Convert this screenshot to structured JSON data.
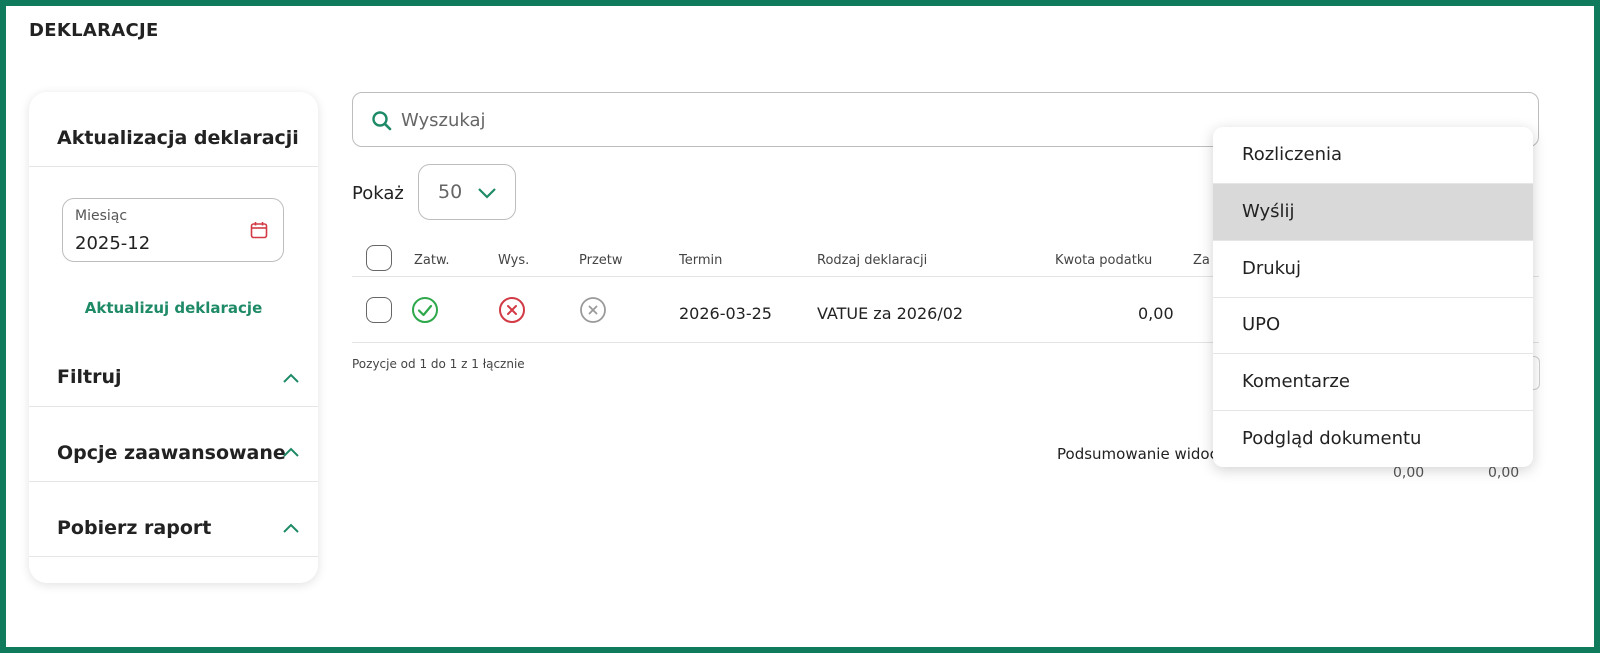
{
  "page": {
    "title": "DEKLARACJE"
  },
  "sidebar": {
    "update_heading": "Aktualizacja deklaracji",
    "month_label": "Miesiąc",
    "month_value": "2025-12",
    "update_link": "Aktualizuj deklaracje",
    "sections": [
      {
        "label": "Filtruj"
      },
      {
        "label": "Opcje zaawansowane"
      },
      {
        "label": "Pobierz raport"
      }
    ]
  },
  "search": {
    "placeholder": "Wyszukaj"
  },
  "show": {
    "label": "Pokaż",
    "value": "50"
  },
  "table": {
    "headers": [
      "Zatw.",
      "Wys.",
      "Przetw",
      "Termin",
      "Rodzaj deklaracji",
      "Kwota podatku",
      "Za"
    ],
    "rows": [
      {
        "approved": "yes",
        "sent": "no",
        "processed": "no",
        "termin": "2026-03-25",
        "rodzaj": "VATUE za 2026/02",
        "kwota": "0,00"
      }
    ],
    "position_info": "Pozycje od 1 do 1 z 1 łącznie",
    "summary_label": "Podsumowanie widoc",
    "summary_values": [
      "0,00",
      "0,00"
    ]
  },
  "menu": {
    "items": [
      "Rozliczenia",
      "Wyślij",
      "Drukuj",
      "UPO",
      "Komentarze",
      "Podgląd dokumentu"
    ],
    "active_index": 1
  },
  "colors": {
    "accent": "#0f7a5c",
    "link": "#1f8a67",
    "ok": "#2ea84a",
    "error": "#d23a45",
    "muted": "#9a9a9a",
    "menu_active": "#d9d9d9"
  }
}
